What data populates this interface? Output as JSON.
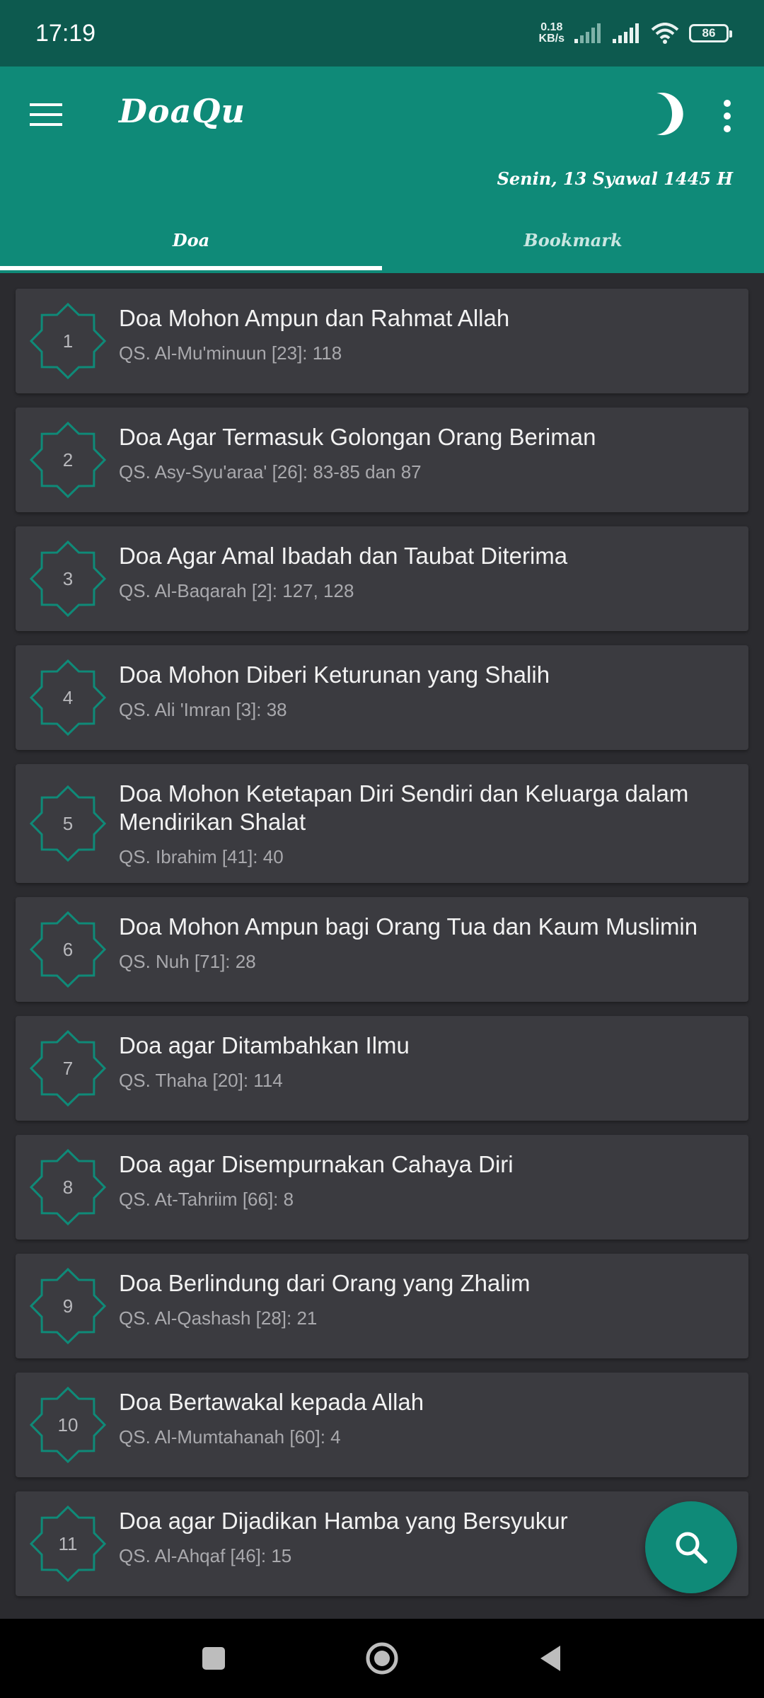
{
  "status_bar": {
    "time": "17:19",
    "net_speed_value": "0.18",
    "net_speed_unit": "KB/s",
    "battery": "86"
  },
  "app_bar": {
    "title": "DoaQu",
    "hijri_date": "Senin, 13 Syawal 1445 H",
    "icons": [
      "menu-icon",
      "moon-icon",
      "more-vert-icon"
    ]
  },
  "tabs": [
    {
      "label": "Doa",
      "selected": true
    },
    {
      "label": "Bookmark",
      "selected": false
    }
  ],
  "items": [
    {
      "number": "1",
      "title": "Doa Mohon Ampun dan Rahmat Allah",
      "reference": "QS. Al-Mu'minuun [23]: 118"
    },
    {
      "number": "2",
      "title": "Doa Agar Termasuk Golongan Orang Beriman",
      "reference": "QS. Asy-Syu'araa' [26]: 83-85 dan 87"
    },
    {
      "number": "3",
      "title": "Doa Agar Amal Ibadah dan Taubat Diterima",
      "reference": "QS. Al-Baqarah [2]: 127, 128"
    },
    {
      "number": "4",
      "title": "Doa Mohon Diberi Keturunan yang Shalih",
      "reference": "QS. Ali 'Imran [3]: 38"
    },
    {
      "number": "5",
      "title": "Doa Mohon Ketetapan Diri Sendiri dan Keluarga dalam Mendirikan Shalat",
      "reference": "QS. Ibrahim [41]: 40"
    },
    {
      "number": "6",
      "title": "Doa Mohon Ampun bagi Orang Tua dan Kaum Muslimin",
      "reference": "QS. Nuh [71]: 28"
    },
    {
      "number": "7",
      "title": "Doa agar Ditambahkan Ilmu",
      "reference": "QS. Thaha [20]: 114"
    },
    {
      "number": "8",
      "title": "Doa agar Disempurnakan Cahaya Diri",
      "reference": "QS. At-Tahriim [66]: 8"
    },
    {
      "number": "9",
      "title": "Doa Berlindung dari Orang yang Zhalim",
      "reference": "QS. Al-Qashash [28]: 21"
    },
    {
      "number": "10",
      "title": "Doa Bertawakal kepada Allah",
      "reference": "QS. Al-Mumtahanah [60]: 4"
    },
    {
      "number": "11",
      "title": "Doa agar Dijadikan Hamba yang Bersyukur",
      "reference": "QS. Al-Ahqaf [46]: 15"
    }
  ],
  "fab": {
    "icon": "search-icon"
  },
  "nav_bar": {
    "icons": [
      "recents-square-icon",
      "home-circle-icon",
      "back-triangle-icon"
    ]
  },
  "colors": {
    "primary": "#0f8a78",
    "status_bar": "#0d5a4f",
    "background": "#2b2b2f",
    "card": "#3b3b40",
    "badge_outline": "#0f8a78"
  }
}
